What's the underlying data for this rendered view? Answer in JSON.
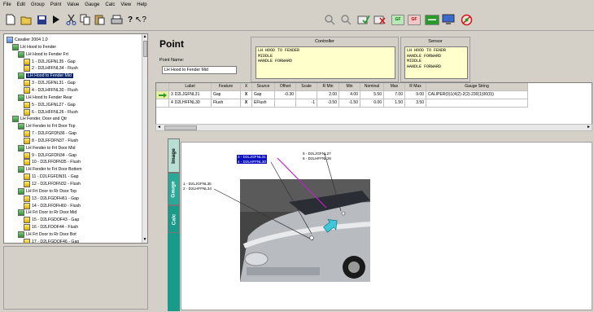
{
  "menu": [
    "File",
    "Edit",
    "Group",
    "Point",
    "Value",
    "Gauge",
    "Calc",
    "View",
    "Help"
  ],
  "toolbar_icons": [
    "new-icon",
    "open-icon",
    "save-icon",
    "play-icon",
    "cut-icon",
    "copy-icon",
    "paste-icon",
    "print-icon",
    "help-icon",
    "whats-this-icon",
    "gauge-search-icon",
    "gauge-search-alt-icon",
    "edit-check-icon",
    "delete-check-icon",
    "gap-flush-icon",
    "gap-flush-alt-icon",
    "meter-icon",
    "monitor-icon",
    "no-sensor-icon"
  ],
  "tree": [
    {
      "label": "Cavalier 2004 1.0",
      "level": 0,
      "icon": "root"
    },
    {
      "label": "LH Hood to Fender",
      "level": 1,
      "icon": "group"
    },
    {
      "label": "LH Hood to Fender Frt",
      "level": 2,
      "icon": "group"
    },
    {
      "label": "1 - D2LJGFNL35 - Gap",
      "level": 3,
      "icon": "leaf"
    },
    {
      "label": "2 - D2LHFFNL34 - Flush",
      "level": 3,
      "icon": "leaf"
    },
    {
      "label": "LH Hood to Fender Mid",
      "level": 2,
      "icon": "group",
      "selected": true
    },
    {
      "label": "3 - D2LJGFNL31 - Gap",
      "level": 3,
      "icon": "leaf"
    },
    {
      "label": "4 - D2LHFFNL30 - Flush",
      "level": 3,
      "icon": "leaf"
    },
    {
      "label": "LH Hood to Fender Rear",
      "level": 2,
      "icon": "group"
    },
    {
      "label": "5 - D2LJGFNL27 - Gap",
      "level": 3,
      "icon": "leaf"
    },
    {
      "label": "6 - D2LHFFNL26 - Flush",
      "level": 3,
      "icon": "leaf"
    },
    {
      "label": "LH Fender, Door and Qtr",
      "level": 1,
      "icon": "group"
    },
    {
      "label": "LH Fender to Frt Door Top",
      "level": 2,
      "icon": "group"
    },
    {
      "label": "7 - D2LFGFDN36 - Gap",
      "level": 3,
      "icon": "leaf"
    },
    {
      "label": "8 - D2LFFDFN37 - Flush",
      "level": 3,
      "icon": "leaf"
    },
    {
      "label": "LH Fender to Frt Door Mid",
      "level": 2,
      "icon": "group"
    },
    {
      "label": "9 - D2LFGFDN34 - Gap",
      "level": 3,
      "icon": "leaf"
    },
    {
      "label": "10 - D2LFFDFN35 - Flush",
      "level": 3,
      "icon": "leaf"
    },
    {
      "label": "LH Fender to Frt Door Bottom",
      "level": 2,
      "icon": "group"
    },
    {
      "label": "11 - D2LFGFDN31 - Gap",
      "level": 3,
      "icon": "leaf"
    },
    {
      "label": "12 - D2LFFDFN32 - Flush",
      "level": 3,
      "icon": "leaf"
    },
    {
      "label": "LH Frt Door to Rr Door Top",
      "level": 2,
      "icon": "group"
    },
    {
      "label": "13 - D2LFGDFH61 - Gap",
      "level": 3,
      "icon": "leaf"
    },
    {
      "label": "14 - D2LFFDFH60 - Flush",
      "level": 3,
      "icon": "leaf"
    },
    {
      "label": "LH Frt Door to Rr Door Mid",
      "level": 2,
      "icon": "group"
    },
    {
      "label": "15 - D2LFGDOF43 - Gap",
      "level": 3,
      "icon": "leaf"
    },
    {
      "label": "16 - D2LFDOF44 - Flush",
      "level": 3,
      "icon": "leaf"
    },
    {
      "label": "LH Frt Door to Rr Door Bot",
      "level": 2,
      "icon": "group"
    },
    {
      "label": "17 - D2LFGDOF46 - Gap",
      "level": 3,
      "icon": "leaf"
    }
  ],
  "point": {
    "title": "Point",
    "name_label": "Point Name:",
    "name_value": "LH Hood to Fender Mid"
  },
  "controller": {
    "title": "Controller",
    "text": "LH HOOD TO FENDER\nMIDDLE\nHANDLE FORWARD"
  },
  "sensor": {
    "title": "Sensor",
    "text": "LH HOOD TO FENDR\nHANDLE FORWARD\nMIDDLE\nHANDLE FORWARD"
  },
  "grid": {
    "columns": [
      "",
      "Label",
      "Feature",
      "X",
      "Source",
      "Offset",
      "Scale",
      "R Min",
      "Min",
      "Nominal",
      "Max",
      "R Max",
      "Gauge String"
    ],
    "rows": [
      [
        "3",
        "D2LJGFNL31",
        "Gap",
        "X",
        "Gap",
        "-0.30",
        "",
        "2.00",
        "4.00",
        "5.50",
        "7.00",
        "9.00",
        "CALIPER(0)1(4(2)-2(2)-230(1)00(0))"
      ],
      [
        "4",
        "D2LHFFNL30",
        "Flush",
        "X",
        "EFlush",
        "",
        "-1",
        "-3.50",
        "-1.50",
        "0.00",
        "1.50",
        "3.50",
        ""
      ]
    ]
  },
  "tabs": [
    "Image",
    "Gauge",
    "Calc"
  ],
  "image_callouts": [
    {
      "text": "3 - D2LJGFNL31\n4 - D2LHFFNL30",
      "highlight": true
    },
    {
      "text": "5 - D2LJGFNL27\n6 - D2LHFFNL26",
      "highlight": false
    },
    {
      "text": "1 - D2LJGFNL35\n2 - D2LHFFNL34",
      "highlight": false
    }
  ],
  "colors": {
    "selection": "#0a246a",
    "memo": "#ffffcc",
    "tab_calc": "#1a9a88",
    "tab_gauge": "#2aa898",
    "tab_image": "#b8dfd4",
    "pointer_line": "#c020c8",
    "arrow": "#40c8d8"
  }
}
